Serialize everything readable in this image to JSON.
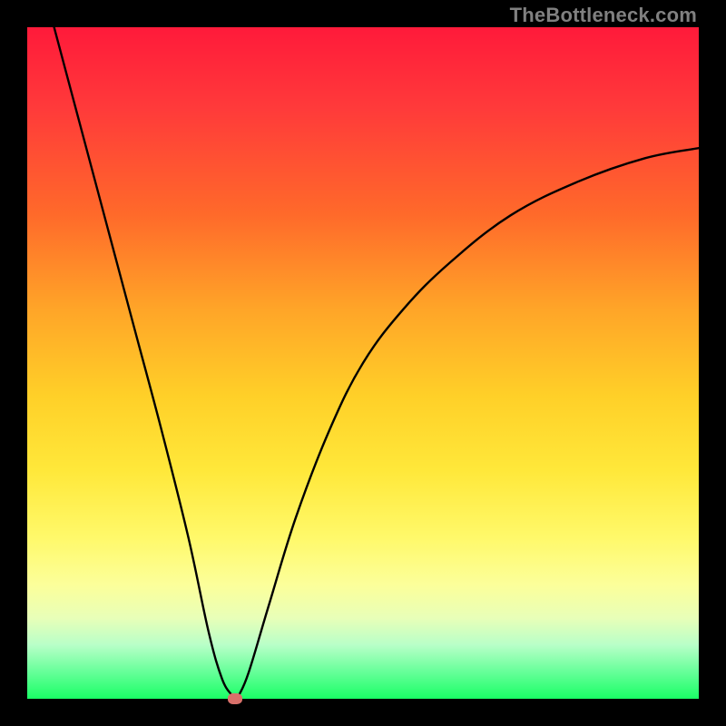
{
  "watermark": "TheBottleneck.com",
  "chart_data": {
    "type": "line",
    "title": "",
    "xlabel": "",
    "ylabel": "",
    "xlim": [
      0,
      100
    ],
    "ylim": [
      0,
      100
    ],
    "grid": false,
    "legend": false,
    "gradient_colors": {
      "top": "#ff1a3a",
      "mid_upper": "#ffa528",
      "mid": "#ffe83a",
      "mid_lower": "#fcff9a",
      "bottom": "#1aff66"
    },
    "series": [
      {
        "name": "bottleneck-curve",
        "color": "#000000",
        "x": [
          4,
          8,
          12,
          16,
          20,
          24,
          27,
          29,
          30.5,
          31,
          31.5,
          33,
          36,
          40,
          45,
          50,
          56,
          63,
          72,
          82,
          92,
          100
        ],
        "y": [
          100,
          85,
          70,
          55,
          40,
          24,
          10,
          3,
          0.5,
          0,
          0.5,
          4,
          14,
          27,
          40,
          50,
          58,
          65,
          72,
          77,
          80.5,
          82
        ]
      }
    ],
    "markers": [
      {
        "name": "minimum-point",
        "x": 31,
        "y": 0,
        "color": "#d9706a"
      }
    ]
  }
}
